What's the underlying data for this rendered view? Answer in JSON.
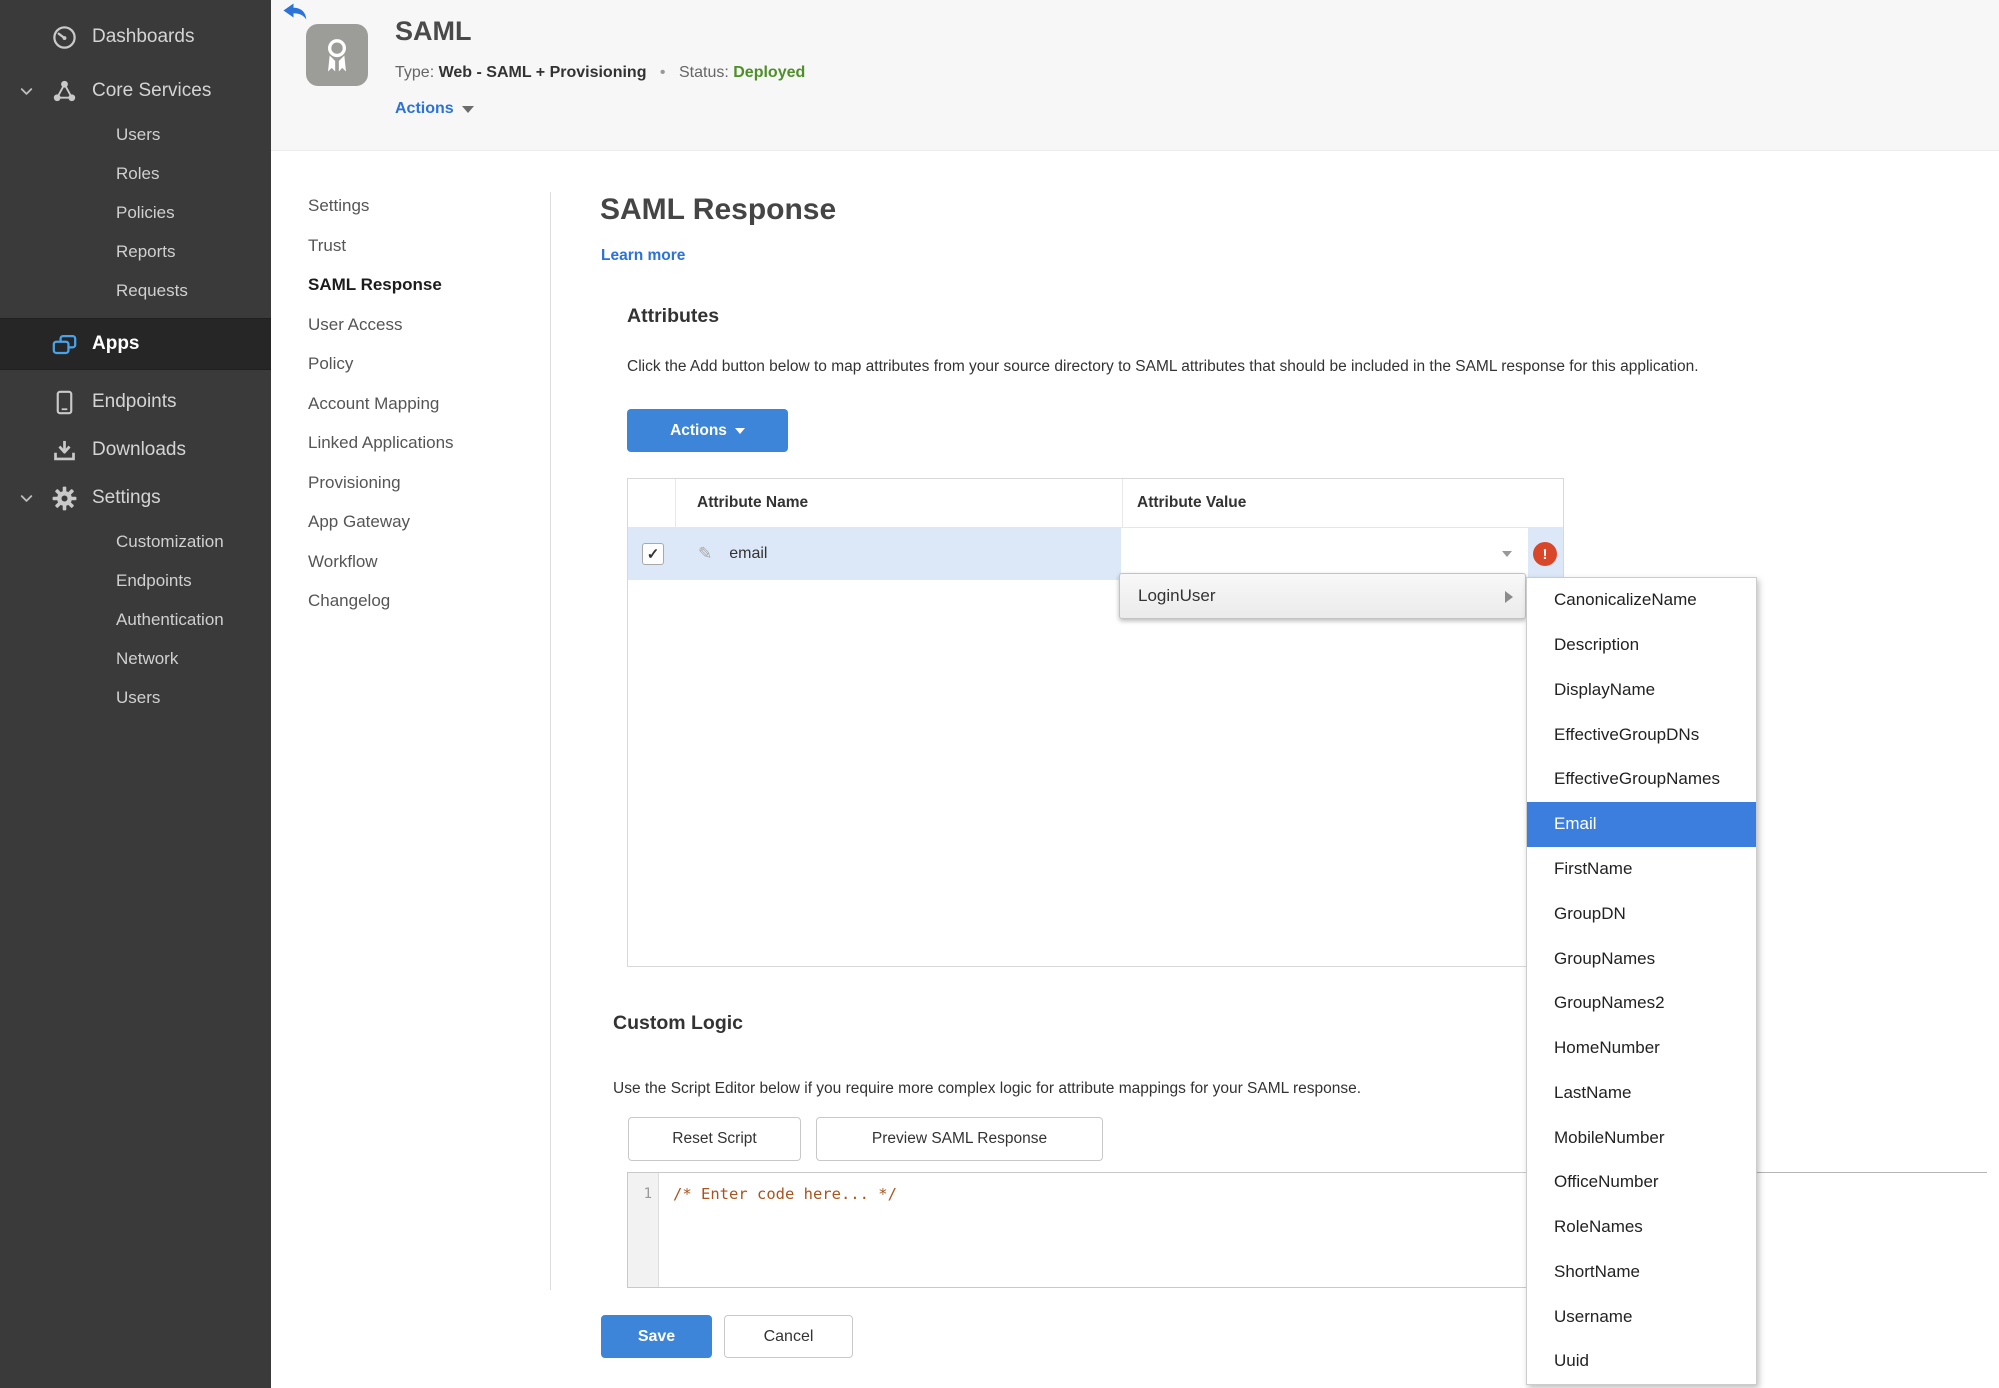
{
  "colors": {
    "accent_blue": "#3d85d8",
    "link_blue": "#2b72d9",
    "status_green": "#4e8f28",
    "error_red": "#d9472b",
    "row_highlight": "#dce8f7",
    "sidebar_bg": "#3a3a3a",
    "sidebar_active_bg": "#262626",
    "menu_selected_blue": "#3b7edd"
  },
  "icons": {
    "check": "✓",
    "pencil": "✎",
    "error_bang": "!"
  },
  "sidebar": {
    "items": [
      {
        "label": "Dashboards",
        "icon": "gauge",
        "level": 0
      },
      {
        "label": "Core Services",
        "icon": "molecule",
        "level": 0,
        "chevron": true,
        "cls": "mt6"
      },
      {
        "label": "Users",
        "level": 1
      },
      {
        "label": "Roles",
        "level": 1
      },
      {
        "label": "Policies",
        "level": 1
      },
      {
        "label": "Reports",
        "level": 1
      },
      {
        "label": "Requests",
        "level": 1
      },
      {
        "label": "Apps",
        "icon": "apps",
        "level": 0,
        "cls": "active mt8"
      },
      {
        "label": "Endpoints",
        "icon": "phone",
        "level": 0,
        "cls": "mt8"
      },
      {
        "label": "Downloads",
        "icon": "download",
        "level": 0
      },
      {
        "label": "Settings",
        "icon": "gear",
        "level": 0,
        "chevron": true
      },
      {
        "label": "Customization",
        "level": 1
      },
      {
        "label": "Endpoints",
        "level": 1
      },
      {
        "label": "Authentication",
        "level": 1
      },
      {
        "label": "Network",
        "level": 1
      },
      {
        "label": "Users",
        "level": 1
      }
    ]
  },
  "header": {
    "title": "SAML",
    "type_label": "Type:",
    "type_value": "Web - SAML + Provisioning",
    "separator": "•",
    "status_label": "Status:",
    "status_value": "Deployed",
    "actions_label": "Actions"
  },
  "subnav": {
    "items": [
      {
        "label": "Settings"
      },
      {
        "label": "Trust"
      },
      {
        "label": "SAML Response",
        "cls": "active"
      },
      {
        "label": "User Access"
      },
      {
        "label": "Policy"
      },
      {
        "label": "Account Mapping"
      },
      {
        "label": "Linked Applications"
      },
      {
        "label": "Provisioning"
      },
      {
        "label": "App Gateway"
      },
      {
        "label": "Workflow"
      },
      {
        "label": "Changelog"
      }
    ]
  },
  "main": {
    "title": "SAML Response",
    "learn_more": "Learn more",
    "attributes": {
      "heading": "Attributes",
      "description": "Click the Add button below to map attributes from your source directory to SAML attributes that should be included in the SAML response for this application.",
      "actions_button": "Actions",
      "table": {
        "columns": [
          "Attribute Name",
          "Attribute Value"
        ],
        "rows": [
          {
            "name": "email",
            "value": "",
            "checked": true,
            "error": true
          }
        ]
      }
    },
    "custom_logic": {
      "heading": "Custom Logic",
      "description": "Use the Script Editor below if you require more complex logic for attribute mappings for your SAML response.",
      "reset_button": "Reset Script",
      "preview_button": "Preview SAML Response",
      "editor": {
        "line_number": "1",
        "code": "/* Enter code here... */"
      }
    },
    "footer": {
      "save": "Save",
      "cancel": "Cancel"
    }
  },
  "value_menu": {
    "parent_label": "LoginUser",
    "selected": "Email",
    "items": [
      {
        "label": "CanonicalizeName"
      },
      {
        "label": "Description"
      },
      {
        "label": "DisplayName"
      },
      {
        "label": "EffectiveGroupDNs"
      },
      {
        "label": "EffectiveGroupNames"
      },
      {
        "label": "Email",
        "cls": "selected"
      },
      {
        "label": "FirstName"
      },
      {
        "label": "GroupDN"
      },
      {
        "label": "GroupNames"
      },
      {
        "label": "GroupNames2"
      },
      {
        "label": "HomeNumber"
      },
      {
        "label": "LastName"
      },
      {
        "label": "MobileNumber"
      },
      {
        "label": "OfficeNumber"
      },
      {
        "label": "RoleNames"
      },
      {
        "label": "ShortName"
      },
      {
        "label": "Username"
      },
      {
        "label": "Uuid"
      }
    ]
  }
}
